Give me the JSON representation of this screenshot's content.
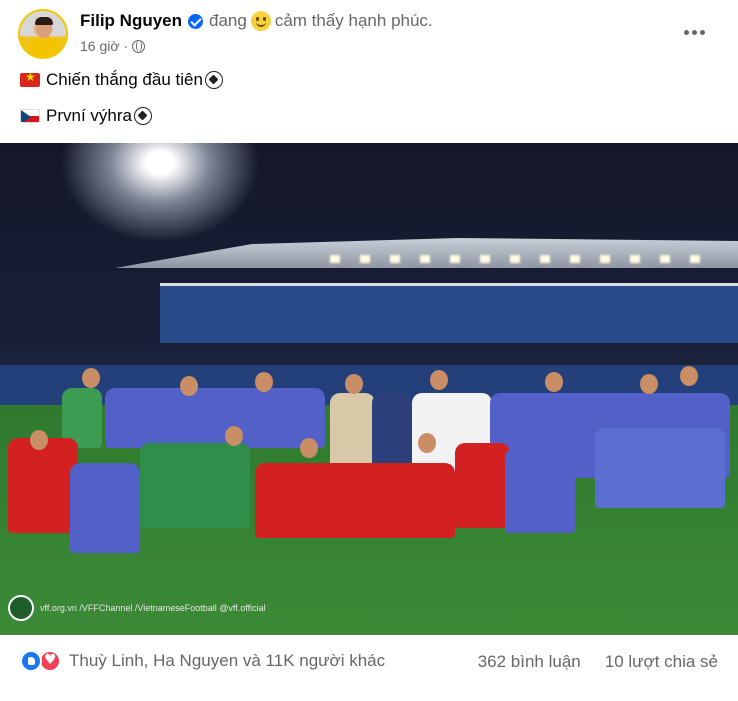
{
  "header": {
    "author": "Filip Nguyen",
    "feeling_prefix": "đang",
    "feeling_text": "cảm thấy hạnh phúc.",
    "time": "16 giờ",
    "separator": "·"
  },
  "post": {
    "lines": [
      {
        "text": "Chiến thắng đầu tiên",
        "flag": "vietnam-flag"
      },
      {
        "text": "První výhra ",
        "flag": "czech-flag"
      }
    ]
  },
  "photo": {
    "watermark": "vff.org.vn   /VFFChannel   /VietnameseFootball   @vff.official"
  },
  "footer": {
    "reaction_summary": "Thuỳ Linh, Ha Nguyen và 11K người khác",
    "comments": "362 bình luận",
    "shares": "10 lượt chia sẻ"
  },
  "colors": {
    "primary_text": "#050505",
    "secondary_text": "#65676b",
    "verified_blue": "#0866ff",
    "like_blue": "#1877f2",
    "love_red": "#f33e58",
    "jersey_red": "#d32020",
    "jersey_purple": "#5360c7"
  }
}
